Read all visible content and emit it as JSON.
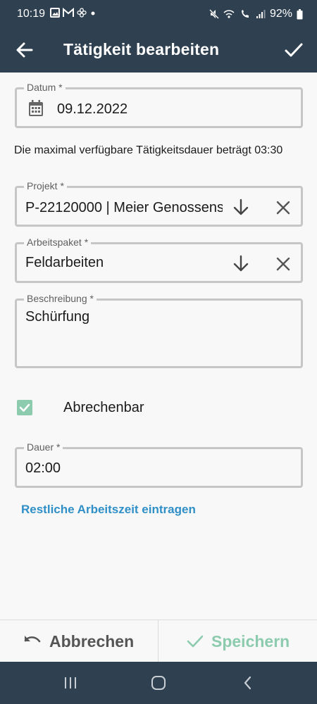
{
  "status": {
    "time": "10:19",
    "battery": "92%"
  },
  "appbar": {
    "title": "Tätigkeit bearbeiten"
  },
  "form": {
    "datum": {
      "label": "Datum *",
      "value": "09.12.2022"
    },
    "info": "Die maximal verfügbare Tätigkeitsdauer beträgt 03:30",
    "projekt": {
      "label": "Projekt *",
      "value": "P-22120000 | Meier Genossens"
    },
    "arbeitspaket": {
      "label": "Arbeitspaket *",
      "value": "Feldarbeiten"
    },
    "beschreibung": {
      "label": "Beschreibung *",
      "value": "Schürfung"
    },
    "abrechenbar": {
      "label": "Abrechenbar",
      "checked": true
    },
    "dauer": {
      "label": "Dauer *",
      "value": "02:00"
    },
    "link": "Restliche Arbeitszeit eintragen"
  },
  "actions": {
    "cancel": "Abbrechen",
    "save": "Speichern"
  },
  "colors": {
    "header": "#2f4050",
    "accent_green": "#8ccbae",
    "link_blue": "#2f8fc7"
  }
}
